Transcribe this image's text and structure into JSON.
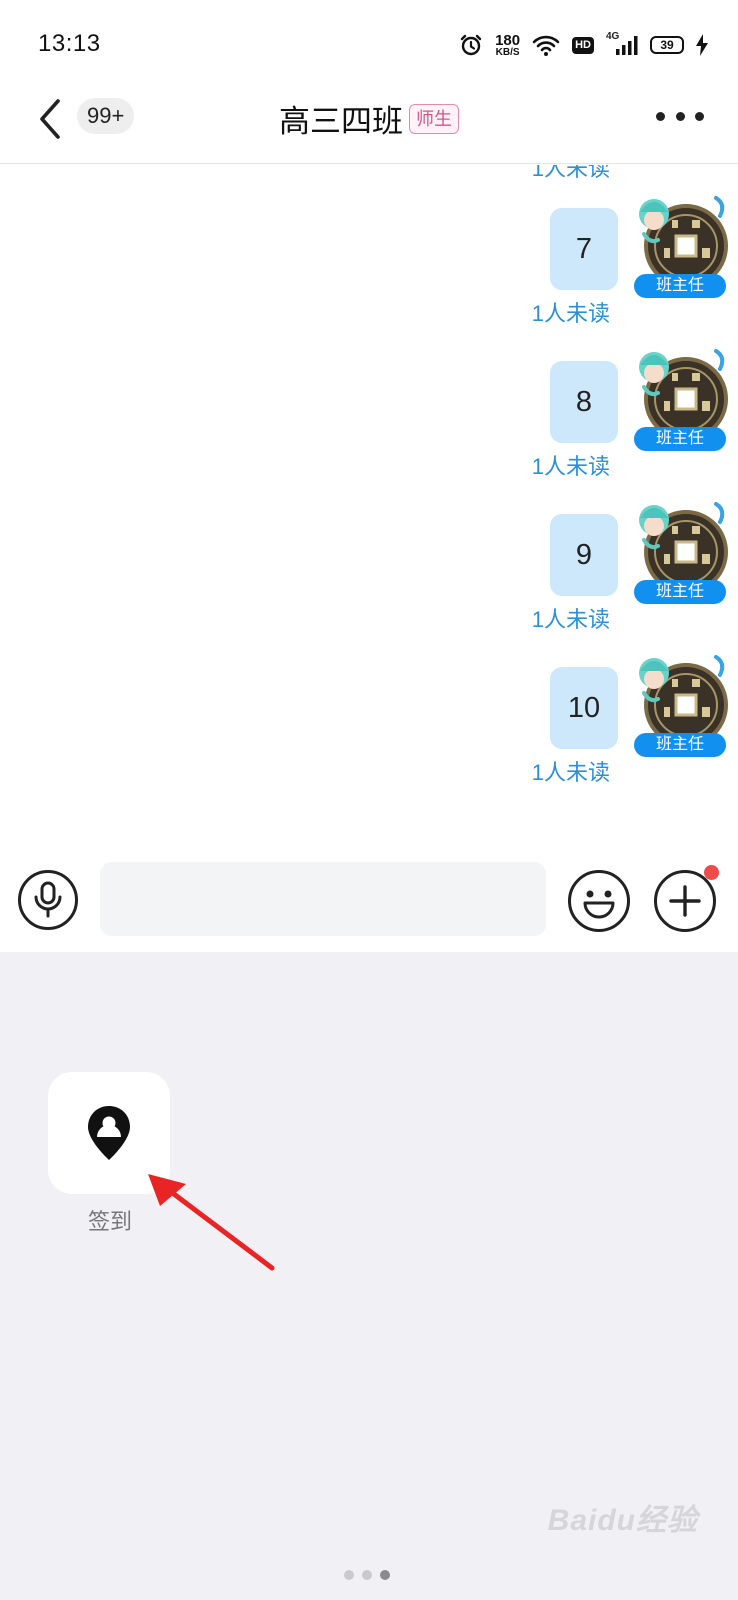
{
  "status_bar": {
    "time": "13:13",
    "net_speed": "180",
    "net_unit": "KB/S",
    "hd_badge": "HD",
    "network": "4G",
    "battery": "39"
  },
  "header": {
    "unread_count": "99+",
    "title": "高三四班",
    "tag": "师生"
  },
  "messages": {
    "partial_status": "1人未读",
    "items": [
      {
        "text": "7",
        "status": "1人未读",
        "role": "班主任"
      },
      {
        "text": "8",
        "status": "1人未读",
        "role": "班主任"
      },
      {
        "text": "9",
        "status": "1人未读",
        "role": "班主任"
      },
      {
        "text": "10",
        "status": "1人未读",
        "role": "班主任"
      }
    ]
  },
  "input_bar": {
    "placeholder": "",
    "has_notification": true
  },
  "panel": {
    "tools": [
      {
        "label": "签到",
        "icon": "location-pin-icon"
      }
    ],
    "page_count": 3,
    "active_page": 3
  },
  "watermark": "Baidu经验",
  "colors": {
    "bubble": "#cde7fb",
    "read_status": "#2d8fd6",
    "role_badge": "#1190f0",
    "tag_border": "#e38ab1",
    "arrow": "#e82424",
    "panel_bg": "#f0f0f5"
  }
}
